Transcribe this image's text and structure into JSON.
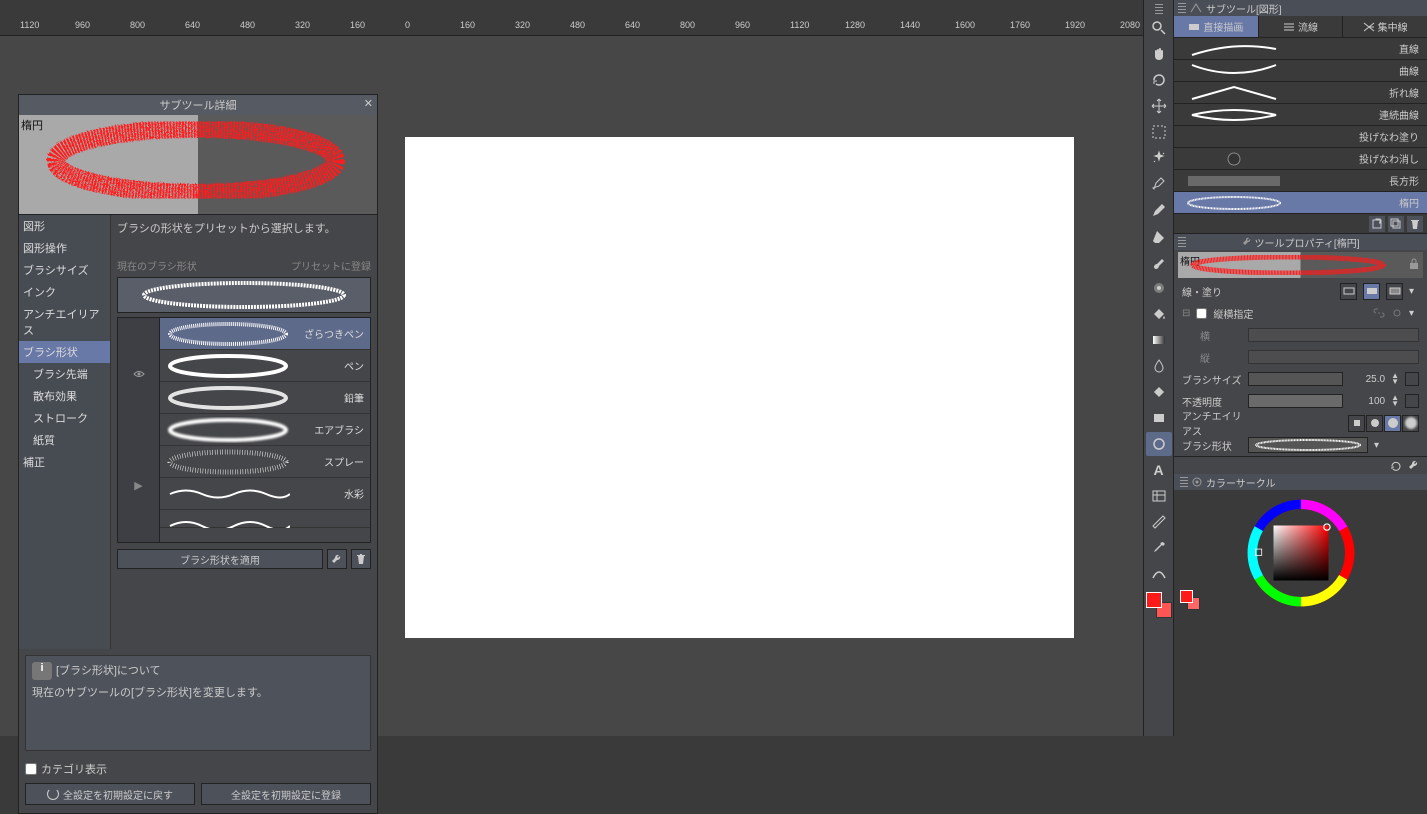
{
  "ruler": {
    "labels": [
      "1120",
      "960",
      "800",
      "640",
      "480",
      "320",
      "160",
      "0",
      "160",
      "320",
      "480",
      "640",
      "800",
      "960",
      "1120",
      "1280",
      "1440",
      "1600",
      "1760",
      "1920",
      "2080"
    ]
  },
  "dialog": {
    "title": "サブツール詳細",
    "preview_tool": "楕円",
    "categories": [
      {
        "label": "図形",
        "sub": false,
        "selected": false
      },
      {
        "label": "図形操作",
        "sub": false,
        "selected": false
      },
      {
        "label": "ブラシサイズ",
        "sub": false,
        "selected": false
      },
      {
        "label": "インク",
        "sub": false,
        "selected": false
      },
      {
        "label": "アンチエイリアス",
        "sub": false,
        "selected": false
      },
      {
        "label": "ブラシ形状",
        "sub": false,
        "selected": true
      },
      {
        "label": "ブラシ先端",
        "sub": true,
        "selected": false
      },
      {
        "label": "散布効果",
        "sub": true,
        "selected": false
      },
      {
        "label": "ストローク",
        "sub": true,
        "selected": false
      },
      {
        "label": "紙質",
        "sub": true,
        "selected": false
      },
      {
        "label": "補正",
        "sub": false,
        "selected": false
      }
    ],
    "description": "ブラシの形状をプリセットから選択します。",
    "current_label": "現在のブラシ形状",
    "register_label": "プリセットに登録",
    "presets": [
      {
        "label": "ざらつきペン",
        "selected": true,
        "style": "dotted"
      },
      {
        "label": "ペン",
        "selected": false,
        "style": "solid"
      },
      {
        "label": "鉛筆",
        "selected": false,
        "style": "soft"
      },
      {
        "label": "エアブラシ",
        "selected": false,
        "style": "blur"
      },
      {
        "label": "スプレー",
        "selected": false,
        "style": "spray"
      },
      {
        "label": "水彩",
        "selected": false,
        "style": "water"
      }
    ],
    "apply_label": "ブラシ形状を適用",
    "info_title": "[ブラシ形状]について",
    "info_body": "現在のサブツールの[ブラシ形状]を変更します。",
    "show_category": "カテゴリ表示",
    "reset_label": "全設定を初期設定に戻す",
    "register_all_label": "全設定を初期設定に登録"
  },
  "right": {
    "subtool_panel_title": "サブツール[図形]",
    "tabs": [
      {
        "label": "直接描画",
        "selected": true
      },
      {
        "label": "流線",
        "selected": false
      },
      {
        "label": "集中線",
        "selected": false
      }
    ],
    "subtools": [
      {
        "label": "直線",
        "selected": false,
        "kind": "line-down"
      },
      {
        "label": "曲線",
        "selected": false,
        "kind": "curve"
      },
      {
        "label": "折れ線",
        "selected": false,
        "kind": "zigzag"
      },
      {
        "label": "連続曲線",
        "selected": false,
        "kind": "leaf"
      },
      {
        "label": "投げなわ塗り",
        "selected": false,
        "kind": "fill"
      },
      {
        "label": "投げなわ消し",
        "selected": false,
        "kind": "lasso"
      },
      {
        "label": "長方形",
        "selected": false,
        "kind": "rect-noise"
      },
      {
        "label": "楕円",
        "selected": true,
        "kind": "ellipse"
      }
    ],
    "tool_property": {
      "title": "ツールプロパティ[楕円]",
      "preview_tool": "楕円",
      "line_fill_label": "線・塗り",
      "aspect_label": "縦横指定",
      "width_label": "横",
      "height_label": "縦",
      "brush_size_label": "ブラシサイズ",
      "brush_size_value": "25.0",
      "opacity_label": "不透明度",
      "opacity_value": "100",
      "aa_label": "アンチエイリアス",
      "shape_label": "ブラシ形状"
    },
    "color_panel": {
      "title": "カラーサークル"
    },
    "foreground_color": "#ff1a1a",
    "background_color": "#ff6666"
  }
}
